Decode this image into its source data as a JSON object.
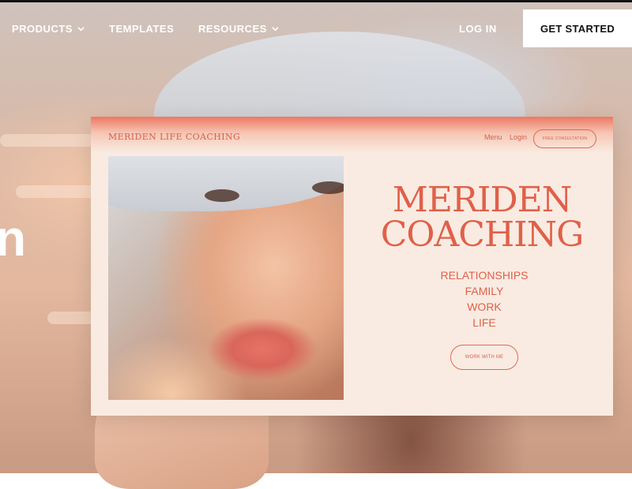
{
  "topnav": {
    "items": [
      {
        "label": "PRODUCTS",
        "has_dropdown": true
      },
      {
        "label": "TEMPLATES",
        "has_dropdown": false
      },
      {
        "label": "RESOURCES",
        "has_dropdown": true
      }
    ],
    "login_label": "LOG IN",
    "cta_label": "GET STARTED"
  },
  "hero": {
    "partial_text": "n"
  },
  "preview": {
    "brand": "MERIDEN LIFE COACHING",
    "menu_label": "Menu",
    "login_label": "Login",
    "consult_label": "FREE CONSULTATION",
    "headline_line1": "MERIDEN",
    "headline_line2": "COACHING",
    "services": [
      "RELATIONSHIPS",
      "FAMILY",
      "WORK",
      "LIFE"
    ],
    "cta_label": "WORK WITH ME"
  },
  "colors": {
    "accent": "#e0604a",
    "preview_bg": "#f9ebe1",
    "nav_text": "#ffffff",
    "cta_bg": "#ffffff"
  },
  "icons": [
    "chevron-down-icon"
  ]
}
